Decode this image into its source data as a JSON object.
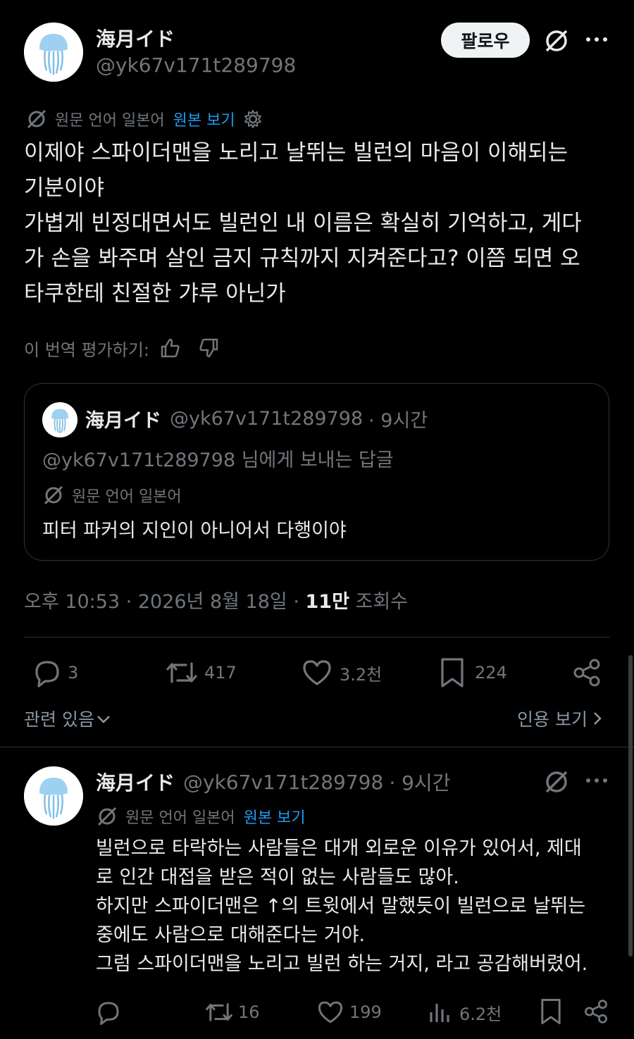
{
  "main": {
    "author_name": "海月イド",
    "author_handle": "@yk67v171t289798",
    "follow_label": "팔로우",
    "translation_note": "원문 언어 일본어",
    "view_original": "원본 보기",
    "text": "이제야 스파이더맨을 노리고 날뛰는 빌런의 마음이 이해되는\n기분이야\n가볍게 빈정대면서도 빌런인 내 이름은 확실히 기억하고, 게다\n가 손을 봐주며 살인 금지 규칙까지 지켜준다고? 이쯤 되면 오\n타쿠한테 친절한 갸루 아닌가",
    "rate_translation": "이 번역 평가하기:",
    "timestamp": "오후 10:53 · 2026년 8월 18일 · ",
    "views_count": "11만",
    "views_label": " 조회수",
    "replies": "3",
    "reposts": "417",
    "likes": "3.2천",
    "bookmarks": "224",
    "related_label": "관련 있음",
    "quotes_label": "인용 보기"
  },
  "quote": {
    "author_name": "海月イド",
    "author_handle": "@yk67v171t289798",
    "time": "· 9시간",
    "reply_to": "@yk67v171t289798 님에게 보내는 답글",
    "translation_note": "원문 언어 일본어",
    "text": "피터 파커의 지인이 아니어서 다행이야"
  },
  "reply": {
    "author_name": "海月イド",
    "author_handle": "@yk67v171t289798",
    "time": "· 9시간",
    "translation_note": "원문 언어 일본어",
    "view_original": "원본 보기",
    "text": "빌런으로 타락하는 사람들은 대개 외로운 이유가 있어서, 제대\n로 인간 대접을 받은 적이 없는 사람들도 많아.\n하지만 스파이더맨은 ↑의 트윗에서 말했듯이 빌런으로 날뛰는\n중에도 사람으로 대해준다는 거야.\n그럼 스파이더맨을 노리고 빌런 하는 거지, 라고 공감해버렸어.",
    "replies": "",
    "reposts": "16",
    "likes": "199",
    "views": "6.2천"
  },
  "colors": {
    "background": "#000000",
    "text": "#e7e9ea",
    "muted": "#71767b",
    "link": "#1d9bf0",
    "border": "#2f3336"
  }
}
